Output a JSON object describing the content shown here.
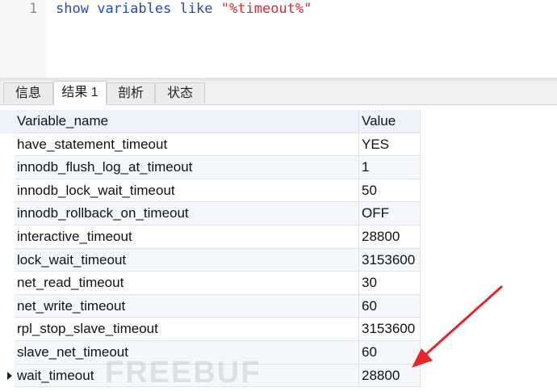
{
  "editor": {
    "line_number": "1",
    "tokens": {
      "show": "show",
      "variables": "variables",
      "like": "like",
      "pattern": "\"%timeout%\""
    }
  },
  "tabs": [
    {
      "label": "信息"
    },
    {
      "label": "结果 1"
    },
    {
      "label": "剖析"
    },
    {
      "label": "状态"
    }
  ],
  "grid": {
    "columns": [
      "Variable_name",
      "Value"
    ],
    "rows": [
      {
        "name": "have_statement_timeout",
        "value": "YES"
      },
      {
        "name": "innodb_flush_log_at_timeout",
        "value": "1"
      },
      {
        "name": "innodb_lock_wait_timeout",
        "value": "50"
      },
      {
        "name": "innodb_rollback_on_timeout",
        "value": "OFF"
      },
      {
        "name": "interactive_timeout",
        "value": "28800"
      },
      {
        "name": "lock_wait_timeout",
        "value": "3153600"
      },
      {
        "name": "net_read_timeout",
        "value": "30"
      },
      {
        "name": "net_write_timeout",
        "value": "60"
      },
      {
        "name": "rpl_stop_slave_timeout",
        "value": "3153600"
      },
      {
        "name": "slave_net_timeout",
        "value": "60"
      },
      {
        "name": "wait_timeout",
        "value": "28800"
      }
    ]
  },
  "watermark": "FREEBUF",
  "colors": {
    "keyword": "#1f49d1",
    "string": "#e8252e",
    "arrow": "#e8252e"
  }
}
